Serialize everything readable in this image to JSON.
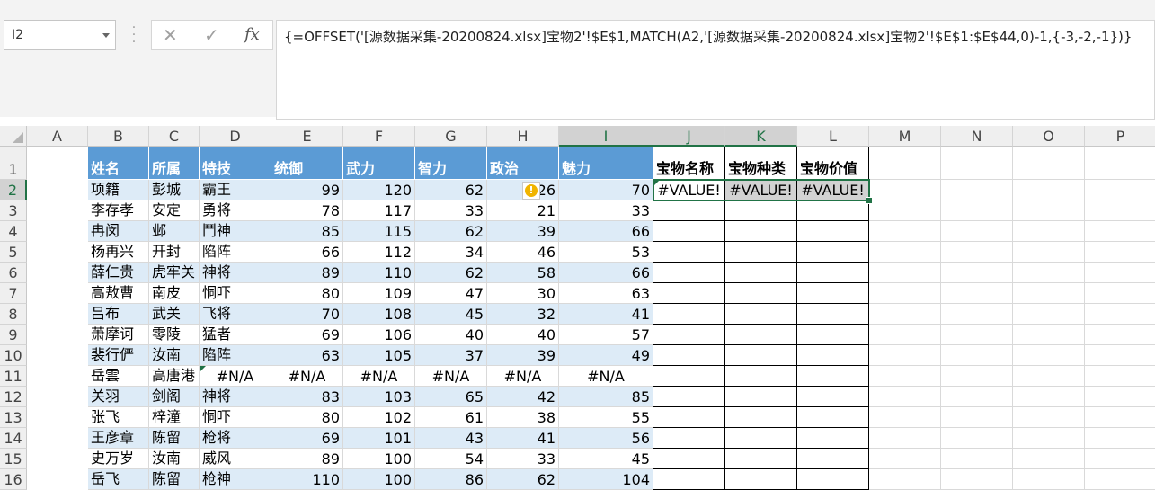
{
  "name_box": {
    "value": "I2"
  },
  "formula_bar": {
    "cancel_glyph": "✕",
    "enter_glyph": "✓",
    "fx_label": "fx",
    "formula": "{=OFFSET('[源数据采集-20200824.xlsx]宝物2'!$E$1,MATCH(A2,'[源数据采集-20200824.xlsx]宝物2'!$E$1:$E$44,0)-1,{-3,-2,-1})}"
  },
  "columns": [
    "A",
    "B",
    "C",
    "D",
    "E",
    "F",
    "G",
    "H",
    "I",
    "J",
    "K",
    "L",
    "M",
    "N",
    "O",
    "P"
  ],
  "selected_columns": [
    "I",
    "J",
    "K"
  ],
  "selected_row": "2",
  "rows": [
    {
      "n": "1",
      "cells": [
        "姓名",
        "所属",
        "特技",
        "统御",
        "武力",
        "智力",
        "政治",
        "魅力",
        "宝物名称",
        "宝物种类",
        "宝物价值"
      ]
    },
    {
      "n": "2",
      "cells": [
        "项籍",
        "彭城",
        "霸王",
        "99",
        "120",
        "62",
        "26",
        "70",
        "#VALUE!",
        "#VALUE!",
        "#VALUE!"
      ]
    },
    {
      "n": "3",
      "cells": [
        "李存孝",
        "安定",
        "勇将",
        "78",
        "117",
        "33",
        "21",
        "33",
        "",
        "",
        ""
      ]
    },
    {
      "n": "4",
      "cells": [
        "冉闵",
        "邺",
        "鬥神",
        "85",
        "115",
        "62",
        "39",
        "66",
        "",
        "",
        ""
      ]
    },
    {
      "n": "5",
      "cells": [
        "杨再兴",
        "开封",
        "陷阵",
        "66",
        "112",
        "34",
        "46",
        "53",
        "",
        "",
        ""
      ]
    },
    {
      "n": "6",
      "cells": [
        "薛仁贵",
        "虎牢关",
        "神将",
        "89",
        "110",
        "62",
        "58",
        "66",
        "",
        "",
        ""
      ]
    },
    {
      "n": "7",
      "cells": [
        "高敖曹",
        "南皮",
        "恫吓",
        "80",
        "109",
        "47",
        "30",
        "63",
        "",
        "",
        ""
      ]
    },
    {
      "n": "8",
      "cells": [
        "吕布",
        "武关",
        "飞将",
        "70",
        "108",
        "45",
        "32",
        "41",
        "",
        "",
        ""
      ]
    },
    {
      "n": "9",
      "cells": [
        "萧摩诃",
        "零陵",
        "猛者",
        "69",
        "106",
        "40",
        "40",
        "57",
        "",
        "",
        ""
      ]
    },
    {
      "n": "10",
      "cells": [
        "裴行俨",
        "汝南",
        "陷阵",
        "63",
        "105",
        "37",
        "39",
        "49",
        "",
        "",
        ""
      ]
    },
    {
      "n": "11",
      "cells": [
        "岳雲",
        "高唐港",
        "#N/A",
        "#N/A",
        "#N/A",
        "#N/A",
        "#N/A",
        "#N/A",
        "",
        "",
        ""
      ]
    },
    {
      "n": "12",
      "cells": [
        "关羽",
        "剑阁",
        "神将",
        "83",
        "103",
        "65",
        "42",
        "85",
        "",
        "",
        ""
      ]
    },
    {
      "n": "13",
      "cells": [
        "张飞",
        "梓潼",
        "恫吓",
        "80",
        "102",
        "61",
        "38",
        "55",
        "",
        "",
        ""
      ]
    },
    {
      "n": "14",
      "cells": [
        "王彦章",
        "陈留",
        "枪将",
        "69",
        "101",
        "43",
        "41",
        "56",
        "",
        "",
        ""
      ]
    },
    {
      "n": "15",
      "cells": [
        "史万岁",
        "汝南",
        "威风",
        "89",
        "100",
        "54",
        "33",
        "45",
        "",
        "",
        ""
      ]
    },
    {
      "n": "16",
      "cells": [
        "岳飞",
        "陈留",
        "枪神",
        "110",
        "100",
        "86",
        "62",
        "104",
        "",
        "",
        ""
      ]
    }
  ],
  "warning_icon": "!"
}
